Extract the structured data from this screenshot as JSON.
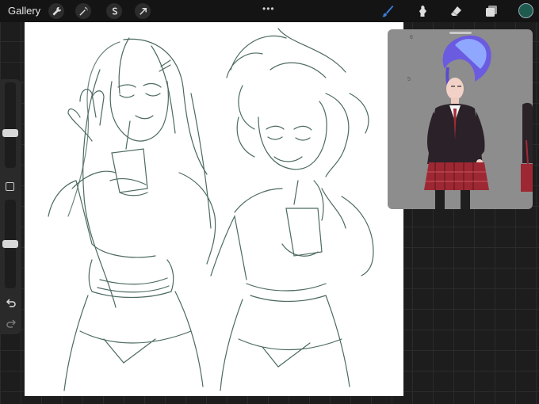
{
  "topbar": {
    "gallery_label": "Gallery",
    "tools": [
      "wrench-icon",
      "magic-wand-icon",
      "selection-s-icon",
      "transform-arrow-icon"
    ],
    "menu_dots": "•••",
    "right_tools": [
      "brush-icon",
      "smudge-icon",
      "eraser-icon",
      "layers-icon"
    ],
    "current_color": "#1f5a4e"
  },
  "sidebar": {
    "brush_size_level": 0.4,
    "opacity_level": 0.5
  },
  "reference": {
    "marks": [
      "6",
      "5"
    ]
  },
  "colors": {
    "sketch_stroke": "#4c6a62",
    "active_tool": "#3a7bd5"
  }
}
